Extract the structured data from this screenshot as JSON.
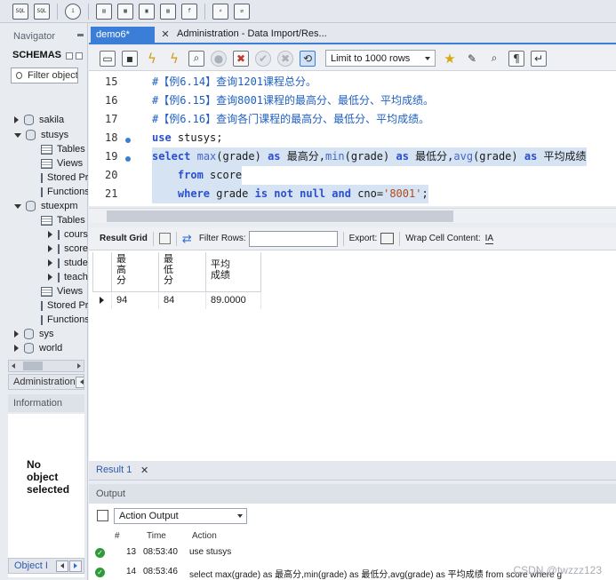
{
  "navigator": {
    "title": "Navigator",
    "schemas_label": "SCHEMAS",
    "filter_placeholder": "Filter objects",
    "tree": [
      {
        "label": "sakila",
        "kind": "db",
        "expanded": false
      },
      {
        "label": "stusys",
        "kind": "db",
        "expanded": true
      },
      {
        "label": "Tables",
        "kind": "folder"
      },
      {
        "label": "Views",
        "kind": "folder"
      },
      {
        "label": "Stored Procedures",
        "kind": "folder"
      },
      {
        "label": "Functions",
        "kind": "folder"
      },
      {
        "label": "stuexpm",
        "kind": "db",
        "expanded": true
      },
      {
        "label": "Tables",
        "kind": "folder"
      },
      {
        "label": "course",
        "kind": "table"
      },
      {
        "label": "score",
        "kind": "table"
      },
      {
        "label": "student",
        "kind": "table"
      },
      {
        "label": "teacher",
        "kind": "table"
      },
      {
        "label": "Views",
        "kind": "folder"
      },
      {
        "label": "Stored Procedures",
        "kind": "folder"
      },
      {
        "label": "Functions",
        "kind": "folder"
      },
      {
        "label": "sys",
        "kind": "db",
        "expanded": false
      },
      {
        "label": "world",
        "kind": "db",
        "expanded": false
      }
    ],
    "admin_tab": "Administration",
    "info_header": "Information",
    "no_object": [
      "No",
      "object",
      "selected"
    ],
    "object_tab": "Object Info"
  },
  "tabs": {
    "active": "demo6*",
    "second": "Administration - Data Import/Res..."
  },
  "editor_toolbar": {
    "limit_label": "Limit to 1000 rows"
  },
  "editor": {
    "lines": [
      {
        "num": "15",
        "dot": false,
        "sel": false,
        "parts": [
          {
            "t": "#【例6.14】查询1201课程总分。",
            "c": "cm"
          }
        ]
      },
      {
        "num": "16",
        "dot": false,
        "sel": false,
        "parts": [
          {
            "t": "#【例6.15】查询8001课程的最高分、最低分、平均成绩。",
            "c": "cm"
          }
        ]
      },
      {
        "num": "17",
        "dot": false,
        "sel": false,
        "parts": [
          {
            "t": "#【例6.16】查询各门课程的最高分、最低分、平均成绩。",
            "c": "cm"
          }
        ]
      },
      {
        "num": "18",
        "dot": true,
        "sel": false,
        "parts": [
          {
            "t": "use",
            "c": "kw"
          },
          {
            "t": " stusys;",
            "c": "plain"
          }
        ]
      },
      {
        "num": "19",
        "dot": true,
        "sel": true,
        "parts": [
          {
            "t": "select",
            "c": "kw"
          },
          {
            "t": " ",
            "c": "plain"
          },
          {
            "t": "max",
            "c": "fn"
          },
          {
            "t": "(grade) ",
            "c": "plain"
          },
          {
            "t": "as",
            "c": "kw"
          },
          {
            "t": " 最高分,",
            "c": "plain"
          },
          {
            "t": "min",
            "c": "fn"
          },
          {
            "t": "(grade) ",
            "c": "plain"
          },
          {
            "t": "as",
            "c": "kw"
          },
          {
            "t": " 最低分,",
            "c": "plain"
          },
          {
            "t": "avg",
            "c": "fn"
          },
          {
            "t": "(grade) ",
            "c": "plain"
          },
          {
            "t": "as",
            "c": "kw"
          },
          {
            "t": " 平均成绩",
            "c": "plain"
          }
        ]
      },
      {
        "num": "20",
        "dot": false,
        "sel": true,
        "parts": [
          {
            "t": "    ",
            "c": "plain"
          },
          {
            "t": "from",
            "c": "kw"
          },
          {
            "t": " score",
            "c": "plain"
          }
        ]
      },
      {
        "num": "21",
        "dot": false,
        "sel": true,
        "parts": [
          {
            "t": "    ",
            "c": "plain"
          },
          {
            "t": "where",
            "c": "kw"
          },
          {
            "t": " grade ",
            "c": "plain"
          },
          {
            "t": "is not null and",
            "c": "kw"
          },
          {
            "t": " cno=",
            "c": "plain"
          },
          {
            "t": "'8001'",
            "c": "str"
          },
          {
            "t": ";",
            "c": "plain"
          }
        ]
      }
    ]
  },
  "result_toolbar": {
    "result_grid": "Result Grid",
    "filter_rows": "Filter Rows:",
    "export": "Export:",
    "wrap": "Wrap Cell Content:"
  },
  "result_grid": {
    "columns": [
      [
        "最",
        "高",
        "分"
      ],
      [
        "最",
        "低",
        "分"
      ],
      [
        "平均",
        "成绩"
      ]
    ],
    "rows": [
      [
        "94",
        "84",
        "89.0000"
      ]
    ]
  },
  "result_tab": "Result 1",
  "output": {
    "header": "Output",
    "selector": "Action Output",
    "columns": [
      "#",
      "Time",
      "Action"
    ],
    "rows": [
      {
        "num": "13",
        "time": "08:53:40",
        "action": "use stusys"
      },
      {
        "num": "14",
        "time": "08:53:46",
        "action": "select max(grade) as 最高分,min(grade) as 最低分,avg(grade) as 平均成绩    from score    where g"
      }
    ]
  },
  "watermark": "CSDN @twzzz123",
  "colors": {
    "accent": "#3b7ed8",
    "selection": "#d6e3f3",
    "keyword": "#2a4fd1",
    "comment": "#1f5fbf",
    "ok": "#2f9a3a"
  }
}
